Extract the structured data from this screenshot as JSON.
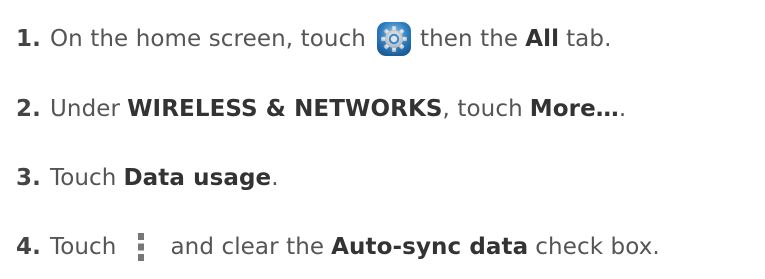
{
  "steps": [
    {
      "number": "1.",
      "text_a": "On the home screen, touch",
      "icon": "settings-gear-icon",
      "text_b": "then the",
      "bold_1": "All",
      "text_c": "tab."
    },
    {
      "number": "2.",
      "text_a": "Under",
      "bold_1": "WIRELESS & NETWORKS",
      "text_b": ", touch",
      "bold_2": "More…",
      "text_c": "."
    },
    {
      "number": "3.",
      "text_a": "Touch",
      "bold_1": "Data usage",
      "text_b": "."
    },
    {
      "number": "4.",
      "text_a": "Touch",
      "icon": "overflow-menu-icon",
      "text_b": "and clear the",
      "bold_1": "Auto-sync data",
      "text_c": "check box."
    }
  ],
  "colors": {
    "text": "#555555",
    "bold": "#333333",
    "icon_blue": "#2f7fc0",
    "icon_gear": "#c9d2d9"
  }
}
